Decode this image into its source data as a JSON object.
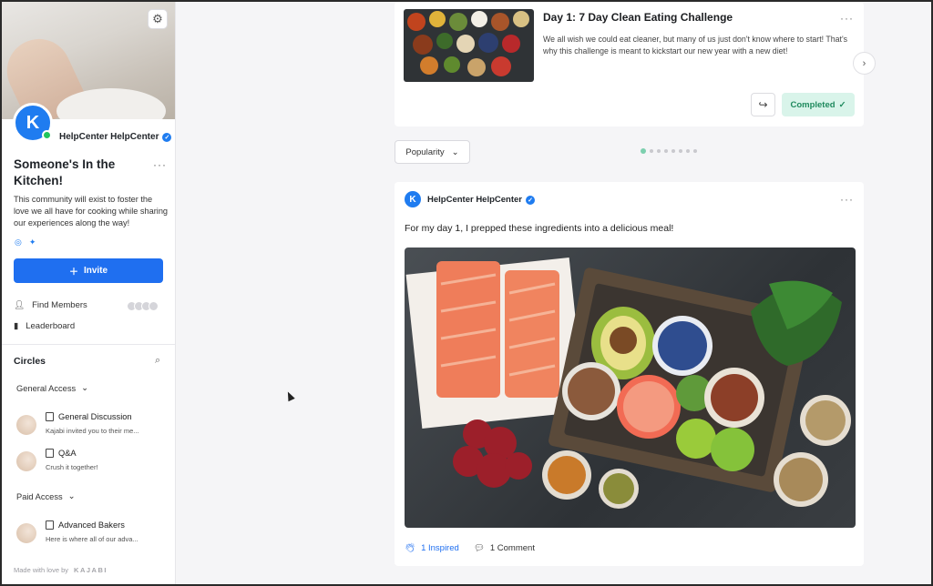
{
  "sidebar": {
    "owner_name": "HelpCenter HelpCenter",
    "community_title": "Someone's In the Kitchen!",
    "community_description": "This community will exist to foster the love we all have for cooking while sharing our experiences along the way!",
    "more_glyph": "···",
    "invite_label": "Invite",
    "find_members_label": "Find Members",
    "leaderboard_label": "Leaderboard",
    "circles_heading": "Circles",
    "groups": [
      {
        "label": "General Access"
      },
      {
        "label": "Paid Access"
      }
    ],
    "circles": [
      {
        "name": "General Discussion",
        "subtitle": "Kajabi invited you to their me..."
      },
      {
        "name": "Q&A",
        "subtitle": "Crush it together!"
      },
      {
        "name": "Advanced Bakers",
        "subtitle": "Here is where all of our adva..."
      }
    ],
    "footer_text": "Made with love by",
    "footer_brand": "KAJABI"
  },
  "challenge": {
    "title": "Day 1: 7 Day Clean Eating Challenge",
    "description": "We all wish we could eat cleaner, but many of us just don't know where to start! That's why this challenge is meant to kickstart our new year with a new diet!",
    "more_glyph": "···",
    "completed_label": "Completed",
    "check_glyph": "✓",
    "share_glyph": "↪",
    "next_glyph": "›"
  },
  "sort": {
    "label": "Popularity"
  },
  "carousel": {
    "page_count": 8,
    "active_index": 0
  },
  "post": {
    "author": "HelpCenter HelpCenter",
    "text": "For my day 1, I prepped these ingredients into a delicious meal!",
    "more_glyph": "···",
    "inspired_label": "1 Inspired",
    "comment_label": "1 Comment"
  },
  "colors": {
    "accent": "#1f6ff0",
    "completed_bg": "#d9f4ea",
    "completed_text": "#1f8a5e",
    "online": "#22c55e"
  },
  "icons": [
    "gear-icon",
    "instagram-icon",
    "twitter-icon",
    "plus-icon",
    "person-icon",
    "leaderboard-icon",
    "search-icon",
    "chevron-down-icon",
    "document-icon",
    "share-icon",
    "check-icon",
    "chevron-right-icon",
    "clap-icon",
    "comment-icon",
    "verified-icon"
  ]
}
